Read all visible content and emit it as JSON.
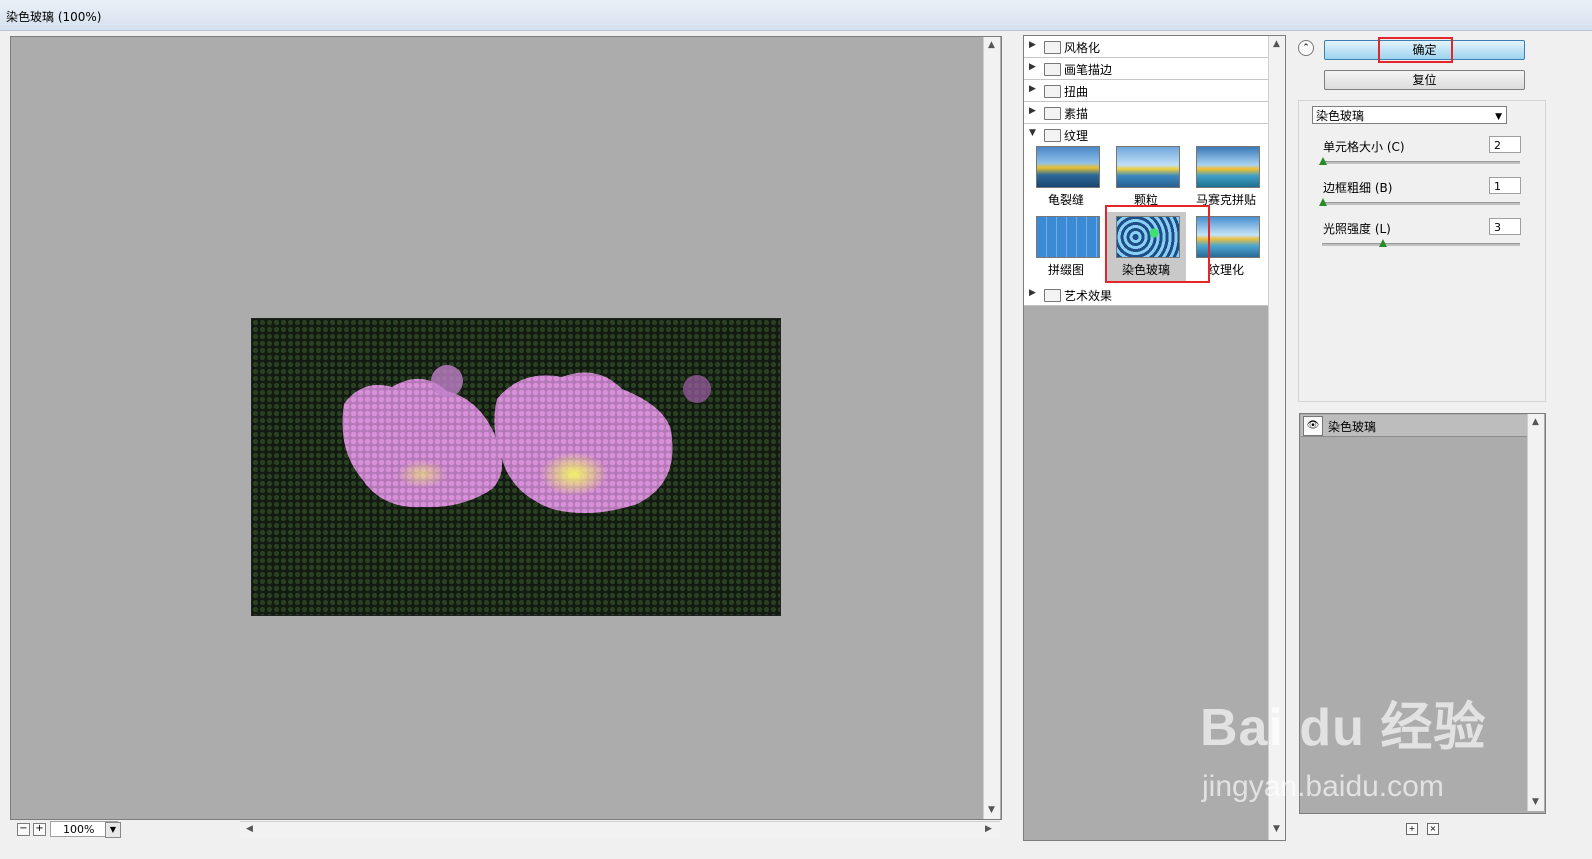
{
  "window": {
    "title": "染色玻璃 (100%)"
  },
  "preview": {
    "zoom": "100%"
  },
  "gallery": {
    "categories_top": [
      {
        "label": "风格化"
      },
      {
        "label": "画笔描边"
      },
      {
        "label": "扭曲"
      },
      {
        "label": "素描"
      }
    ],
    "open_category": "纹理",
    "thumbnails": [
      {
        "label": "龟裂缝"
      },
      {
        "label": "颗粒"
      },
      {
        "label": "马赛克拼贴"
      },
      {
        "label": "拼缀图"
      },
      {
        "label": "染色玻璃"
      },
      {
        "label": "纹理化"
      }
    ],
    "selected_thumbnail": "染色玻璃",
    "categories_bottom": [
      {
        "label": "艺术效果"
      }
    ]
  },
  "buttons": {
    "ok": "确定",
    "reset": "复位"
  },
  "filter_select": {
    "value": "染色玻璃"
  },
  "params": [
    {
      "label": "单元格大小 (C)",
      "value": "2",
      "level_fraction": 0.0
    },
    {
      "label": "边框粗细 (B)",
      "value": "1",
      "level_fraction": 0.0
    },
    {
      "label": "光照强度 (L)",
      "value": "3",
      "level_fraction": 0.3
    }
  ],
  "layers": [
    {
      "name": "染色玻璃"
    }
  ],
  "watermark": {
    "brand": "Bai du 经验",
    "url": "jingyan.baidu.com"
  },
  "colors": {
    "highlight": "#e2262a",
    "primary_button": "#9dd3ef",
    "panel_gray": "#acacac"
  }
}
